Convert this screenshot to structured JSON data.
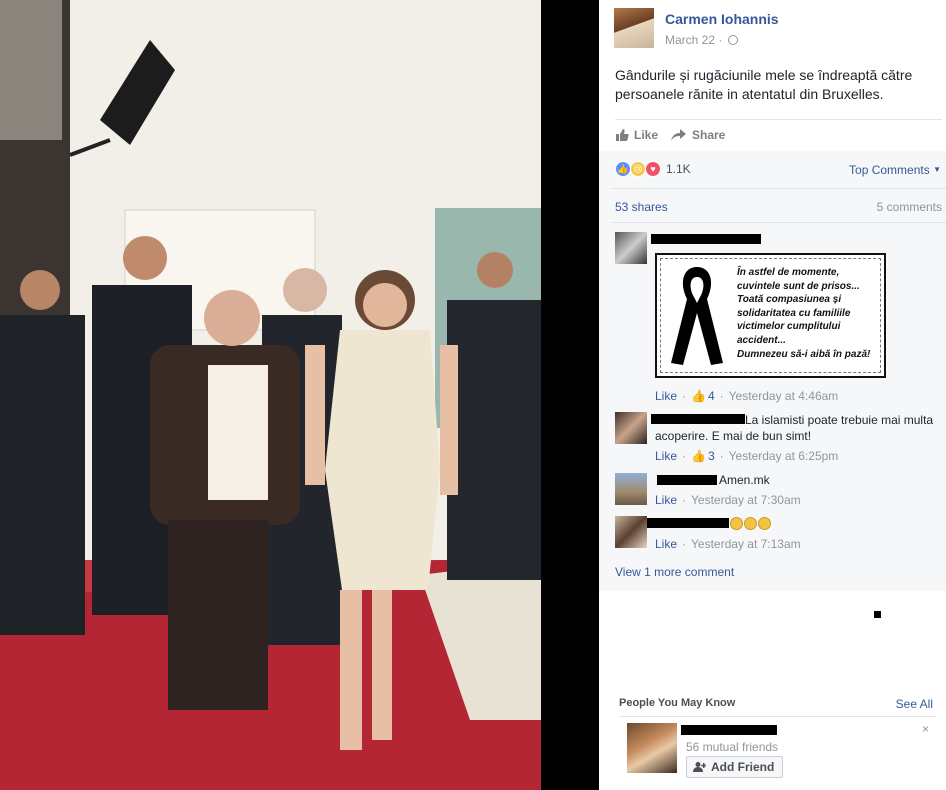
{
  "post": {
    "author": "Carmen Iohannis",
    "date": "March 22",
    "date_separator": "·",
    "text": "Gândurile și rugăciunile mele se îndreaptă către persoanele rănite in atentatul din Bruxelles."
  },
  "actions": {
    "like": "Like",
    "share": "Share"
  },
  "reactions": {
    "icons": [
      "like-reaction",
      "sad-reaction",
      "love-reaction"
    ],
    "count": "1.1K"
  },
  "sort_label": "Top Comments",
  "shares": "53 shares",
  "comments_count": "5 comments",
  "comments": [
    {
      "image_caption_lines": [
        "În astfel de momente,",
        "cuvintele sunt de prisos...",
        "Toată compasiunea și",
        "solidaritatea cu familiile",
        "victimelor cumplitului",
        "accident...",
        "Dumnezeu să-i aibă în pază!"
      ],
      "like": "Like",
      "likes": "4",
      "time": "Yesterday at 4:46am"
    },
    {
      "text": "La islamisti poate trebuie mai multa acoperire. E mai de bun simt!",
      "like": "Like",
      "likes": "3",
      "time": "Yesterday at 6:25pm"
    },
    {
      "text": "Amen.mk",
      "like": "Like",
      "time": "Yesterday at 7:30am"
    },
    {
      "text": "",
      "like": "Like",
      "time": "Yesterday at 7:13am"
    }
  ],
  "view_more": "View 1 more comment",
  "pymk": {
    "title": "People You May Know",
    "see_all": "See All",
    "mutual": "56 mutual friends",
    "add_friend": "Add Friend",
    "close": "×"
  },
  "colors": {
    "link": "#365899",
    "muted": "#90949c",
    "carpet": "#a8232e"
  }
}
